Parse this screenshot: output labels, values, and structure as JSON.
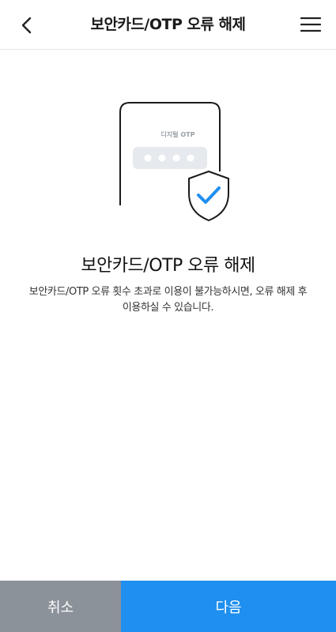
{
  "header": {
    "title": "보안카드/OTP 오류 해제",
    "back_icon": "chevron-left-icon",
    "menu_icon": "hamburger-menu-icon"
  },
  "illustration": {
    "otp_label": "디지털 OTP",
    "icons": [
      "phone-icon",
      "shield-check-icon"
    ]
  },
  "main": {
    "title": "보안카드/OTP 오류 해제",
    "description_line1": "보안카드/OTP 오류 횟수 초과로 이용이 불가능하시면, 오류 해제 후",
    "description_line2": "이용하실 수 있습니다."
  },
  "footer": {
    "cancel_label": "취소",
    "next_label": "다음"
  },
  "colors": {
    "primary": "#1f8ff0",
    "secondary": "#8b9299"
  }
}
